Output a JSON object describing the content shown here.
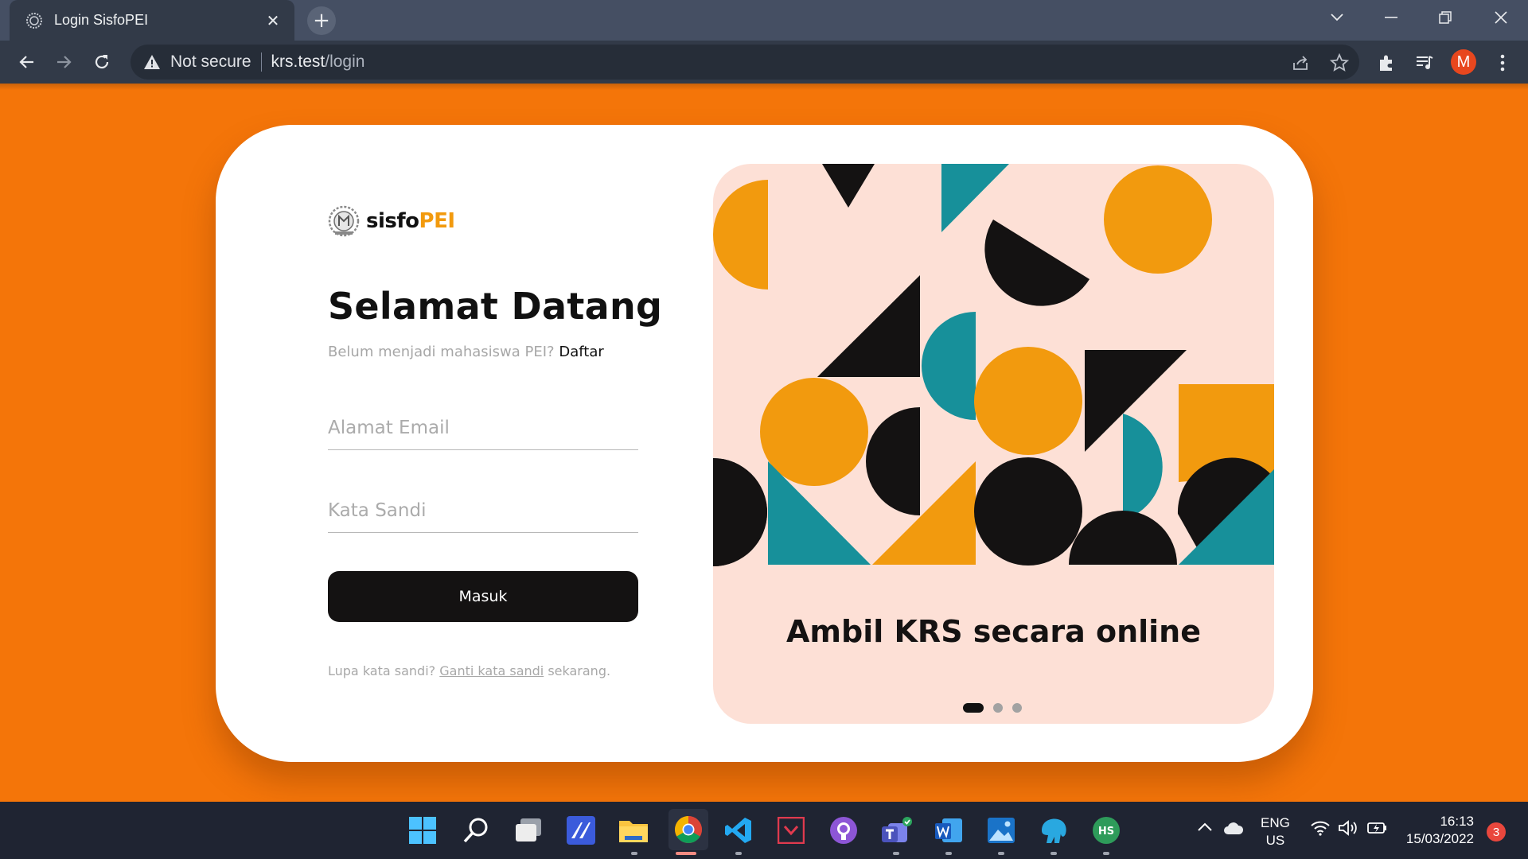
{
  "browser": {
    "tab_title": "Login SisfoPEI",
    "tab_close": "✕",
    "new_tab": "+",
    "security_label": "Not secure",
    "url_host": "krs.test",
    "url_path": "/login",
    "profile_initial": "M"
  },
  "brand": {
    "part1": "sisfo",
    "part2": "PEI"
  },
  "login": {
    "title": "Selamat Datang",
    "signup_prompt": "Belum menjadi mahasiswa PEI?",
    "signup_link": "Daftar",
    "email_placeholder": "Alamat Email",
    "password_placeholder": "Kata Sandi",
    "submit_label": "Masuk",
    "forgot_prompt": "Lupa kata sandi?",
    "forgot_link": "Ganti kata sandi",
    "forgot_suffix": "sekarang."
  },
  "slider": {
    "caption": "Ambil KRS secara online",
    "slides_total": 3,
    "active_slide": 1
  },
  "colors": {
    "page_bg": "#F47509",
    "accent_orange": "#F29A0E",
    "teal": "#17909A",
    "dark": "#141212",
    "panel_bg": "#FDE0D6"
  },
  "taskbar": {
    "apps": [
      "start-icon",
      "search-icon",
      "task-view-icon",
      "dev-app-icon",
      "file-explorer-icon",
      "chrome-icon",
      "vscode-icon",
      "code-tool-icon",
      "github-icon",
      "teams-icon",
      "word-icon",
      "photos-icon",
      "db-tool-icon",
      "hs-app-icon"
    ],
    "lang_line1": "ENG",
    "lang_line2": "US",
    "time": "16:13",
    "date": "15/03/2022",
    "notification_count": "3"
  }
}
